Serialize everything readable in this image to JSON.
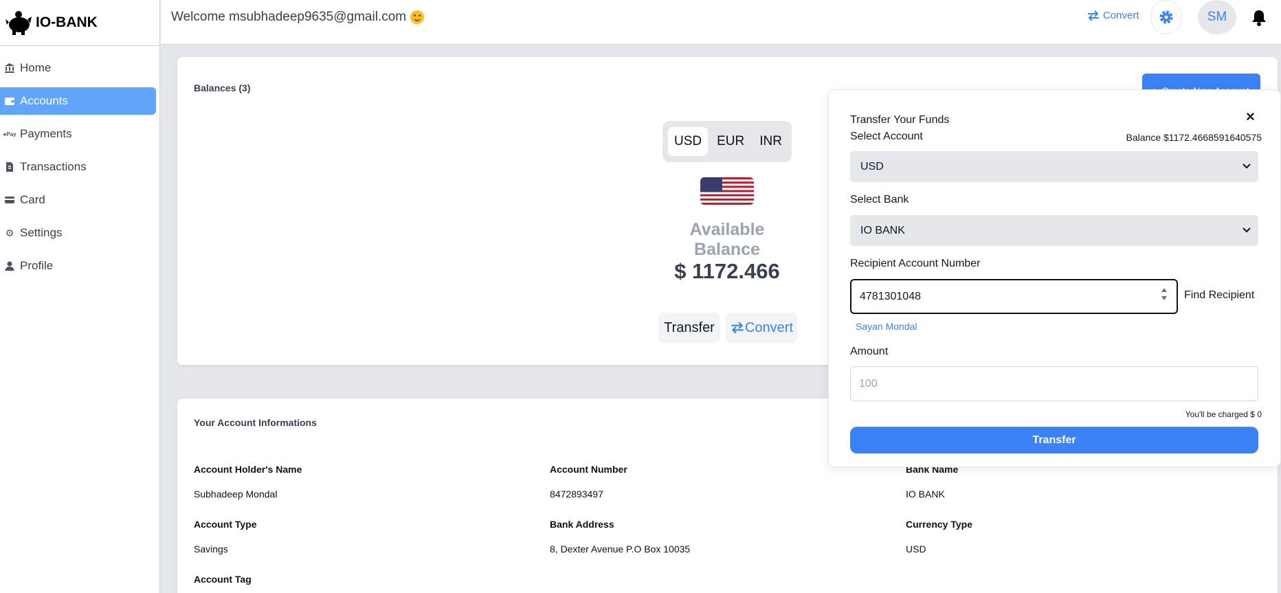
{
  "brand": {
    "name": "IO-BANK"
  },
  "sidebar": {
    "items": [
      {
        "label": "Home",
        "icon": "bank-icon"
      },
      {
        "label": "Accounts",
        "icon": "wallet-icon",
        "active": true
      },
      {
        "label": "Payments",
        "icon": "pay-icon"
      },
      {
        "label": "Transactions",
        "icon": "receipt-icon"
      },
      {
        "label": "Card",
        "icon": "card-icon"
      },
      {
        "label": "Settings",
        "icon": "gear-icon"
      },
      {
        "label": "Profile",
        "icon": "user-icon"
      }
    ]
  },
  "header": {
    "welcome": "Welcome msubhadeep9635@gmail.com",
    "convert_label": "Convert",
    "avatar_initials": "SM"
  },
  "balances": {
    "title": "Balances (3)",
    "create_button": "Create New Account",
    "currency_tabs": [
      "USD",
      "EUR",
      "INR"
    ],
    "selected_currency": "USD",
    "available_label": "Available Balance",
    "available_value": "$ 1172.466",
    "transfer_label": "Transfer",
    "convert_label": "Convert"
  },
  "account_info": {
    "title": "Your Account Informations",
    "fields": [
      {
        "label": "Account Holder's Name",
        "value": "Subhadeep Mondal"
      },
      {
        "label": "Account Number",
        "value": "8472893497"
      },
      {
        "label": "Bank Name",
        "value": "IO BANK"
      },
      {
        "label": "Account Type",
        "value": "Savings"
      },
      {
        "label": "Bank Address",
        "value": "8, Dexter Avenue P.O Box 10035"
      },
      {
        "label": "Currency Type",
        "value": "USD"
      },
      {
        "label": "Account Tag",
        "value": ""
      }
    ]
  },
  "transfer_panel": {
    "title": "Transfer Your Funds",
    "select_account_label": "Select Account",
    "balance_text": "Balance $1172.4668591640575",
    "account_value": "USD",
    "select_bank_label": "Select Bank",
    "bank_value": "IO BANK",
    "recipient_label": "Recipient Account Number",
    "recipient_value": "4781301048",
    "find_recipient": "Find Recipient",
    "recipient_name": "Sayan Mondal",
    "amount_label": "Amount",
    "amount_placeholder": "100",
    "charge_text": "You'll be charged $ 0",
    "transfer_button": "Transfer",
    "close_symbol": "×"
  },
  "colors": {
    "accent": "#3b82f6",
    "active_nav": "#60a5fa"
  }
}
